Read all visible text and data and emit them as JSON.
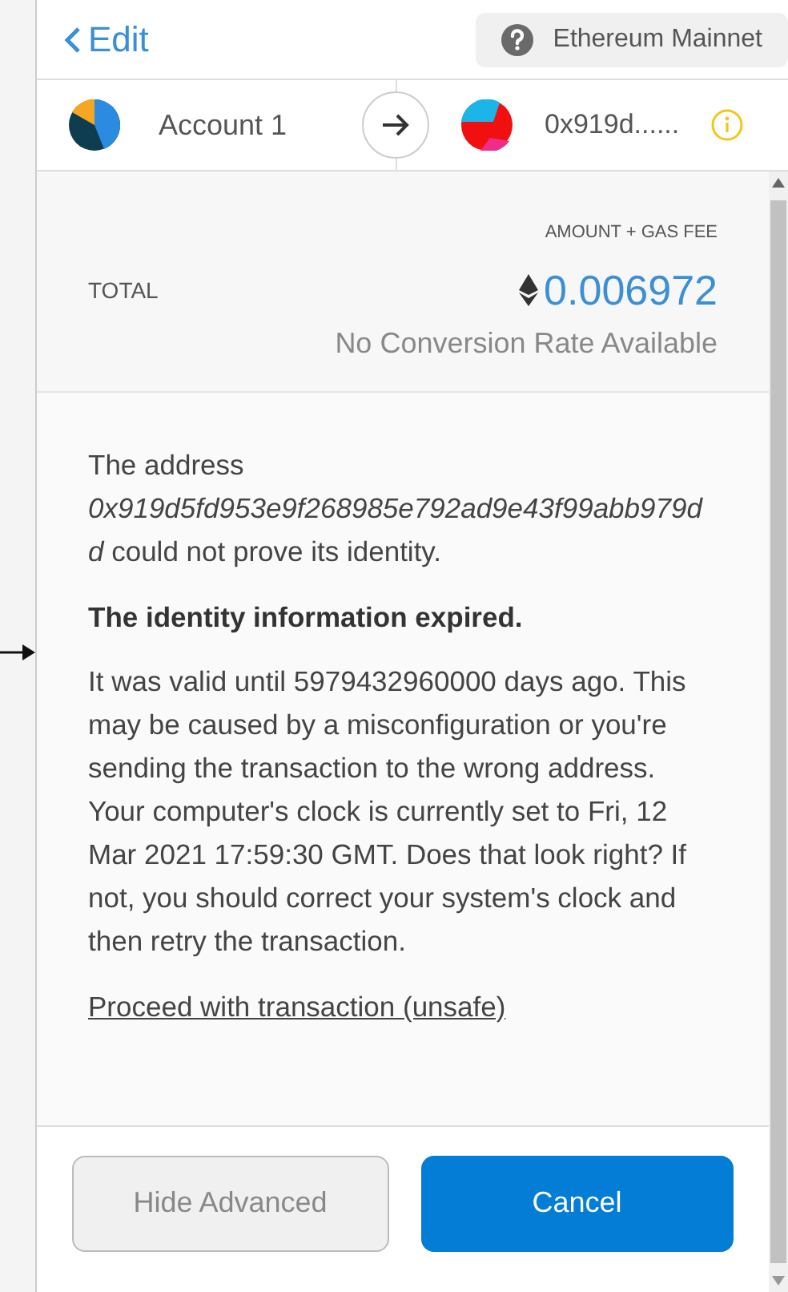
{
  "header": {
    "back_label": "Edit",
    "network": "Ethereum Mainnet"
  },
  "accounts": {
    "from": "Account 1",
    "to": "0x919d......"
  },
  "total": {
    "caption": "AMOUNT + GAS FEE",
    "label": "TOTAL",
    "amount": "0.006972",
    "conversion": "No Conversion Rate Available"
  },
  "warning": {
    "paragraphs": [
      {
        "kind": "text",
        "text": "The address *0x919d5fd953e9f268985e792ad9e43f99abb979dd* could not prove its identity."
      },
      {
        "kind": "heading",
        "text": "The identity information expired."
      },
      {
        "kind": "text",
        "text": "It was valid until 5979432960000 days ago. This may be caused by a misconfiguration or you're sending the transaction to the wrong address. Your computer's clock is currently set to Fri, 12 Mar 2021 17:59:30 GMT. Does that look right? If not, you should correct your system's clock and then retry the transaction."
      }
    ],
    "link": "Proceed with transaction (unsafe)"
  },
  "buttons": [
    {
      "label": "Hide Advanced",
      "kind": "secondary"
    },
    {
      "label": "Cancel",
      "kind": "primary"
    }
  ]
}
